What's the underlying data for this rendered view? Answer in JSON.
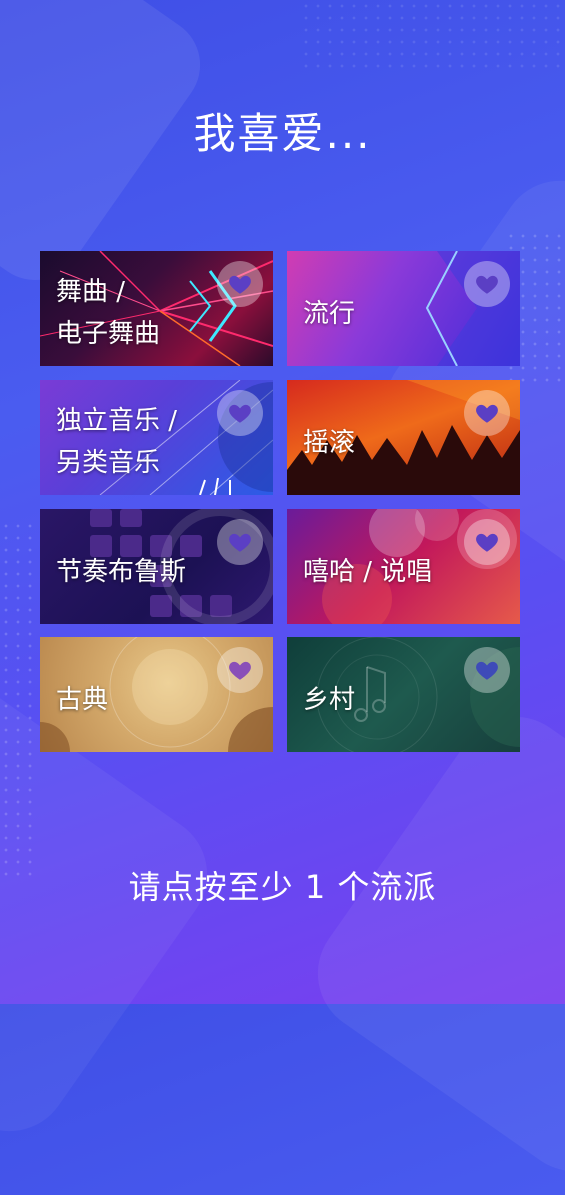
{
  "title": "我喜爱...",
  "genres": [
    {
      "line1": "舞曲 /",
      "line2": "电子舞曲"
    },
    {
      "line1": "流行",
      "line2": ""
    },
    {
      "line1": "独立音乐 /",
      "line2": "另类音乐"
    },
    {
      "line1": "摇滚",
      "line2": ""
    },
    {
      "line1": "节奏布鲁斯",
      "line2": ""
    },
    {
      "line1": "嘻哈 / 说唱",
      "line2": ""
    },
    {
      "line1": "古典",
      "line2": ""
    },
    {
      "line1": "乡村",
      "line2": ""
    }
  ],
  "icon": "heart-icon",
  "footer": "请点按至少 1 个流派",
  "colors": {
    "background": "#4a5cf0",
    "heart": "#5b3fc4"
  }
}
